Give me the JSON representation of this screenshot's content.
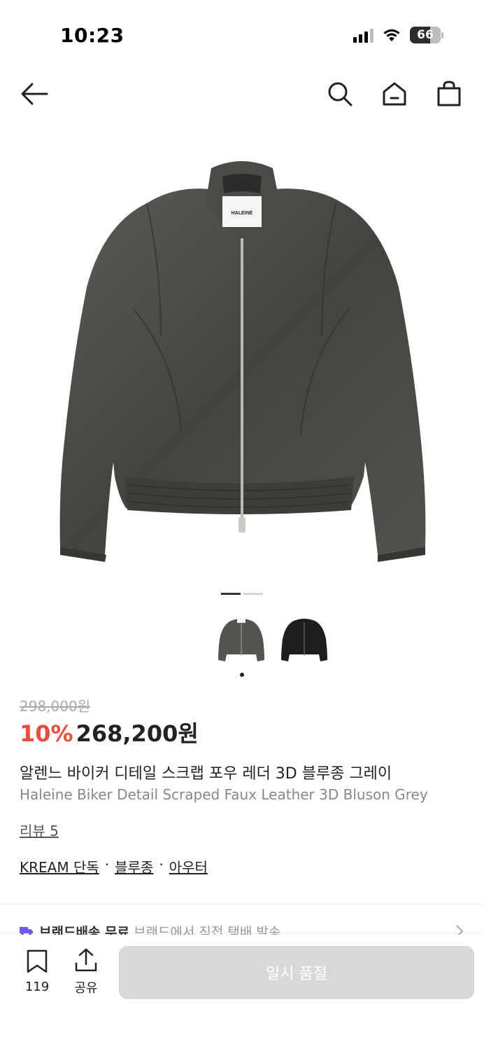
{
  "status": {
    "time": "10:23",
    "battery": "66",
    "battery_level": 0.66
  },
  "nav": {
    "icons": [
      "back-arrow-icon",
      "search-icon",
      "home-icon",
      "shopping-bag-icon"
    ]
  },
  "gallery": {
    "current_index": 1,
    "total": 2,
    "thumbnails": [
      "grey-jacket-thumbnail",
      "black-jacket-thumbnail"
    ],
    "brand_label": "HALEINE"
  },
  "product": {
    "original_price": "298,000원",
    "discount": "10%",
    "price": "268,200원",
    "title_ko": "알렌느 바이커 디테일 스크랩 포우 레더 3D 블루종 그레이",
    "title_en": "Haleine Biker Detail Scraped Faux Leather 3D Bluson Grey",
    "review": "리뷰 5",
    "tags": [
      "KREAM 단독",
      "블루종",
      "아우터"
    ],
    "tag_separator": "·"
  },
  "delivery": {
    "title": "브랜드배송 무료",
    "subtitle": "브랜드에서 직접 택배 발송"
  },
  "bottom": {
    "bookmark_count": "119",
    "share_label": "공유",
    "action_label": "일시 품절"
  },
  "colors": {
    "accent": "#ef4a3a",
    "delivery_icon": "#6a5af9",
    "disabled_button": "#d9d9d9"
  }
}
